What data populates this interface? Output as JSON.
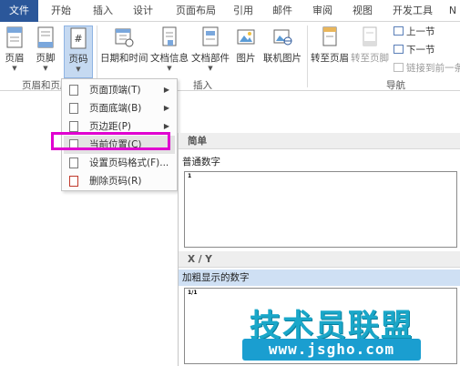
{
  "tabs": [
    {
      "label": "文件"
    },
    {
      "label": "开始"
    },
    {
      "label": "插入"
    },
    {
      "label": "设计"
    },
    {
      "label": "页面布局"
    },
    {
      "label": "引用"
    },
    {
      "label": "邮件"
    },
    {
      "label": "审阅"
    },
    {
      "label": "视图"
    },
    {
      "label": "开发工具"
    },
    {
      "label": "N"
    }
  ],
  "ribbon": {
    "header": "页眉",
    "footer": "页脚",
    "page_number": "页码",
    "datetime": "日期和时间",
    "docinfo": "文档信息",
    "quickparts": "文档部件",
    "picture": "图片",
    "onlinepic": "联机图片",
    "goto_header": "转至页眉",
    "goto_footer": "转至页脚",
    "prev_section": "上一节",
    "next_section": "下一节",
    "link_previous": "链接到前一条",
    "group_header_footer": "页眉和页脚",
    "group_insert": "插入",
    "group_nav": "导航"
  },
  "menu": {
    "items": [
      {
        "label": "页面顶端(T)"
      },
      {
        "label": "页面底端(B)"
      },
      {
        "label": "页边距(P)"
      },
      {
        "label": "当前位置(C)"
      },
      {
        "label": "设置页码格式(F)..."
      },
      {
        "label": "删除页码(R)"
      }
    ]
  },
  "gallery": {
    "section1": "简单",
    "item1": "普通数字",
    "item1_preview": "1",
    "section2": "X / Y",
    "item2": "加粗显示的数字",
    "item2_preview": "1/1"
  },
  "watermark": {
    "title": "技术员联盟",
    "url": "www.jsgho.com"
  },
  "colors": {
    "file_tab": "#2b579a",
    "highlight": "#e000d0",
    "watermark": "#1aa7c9"
  }
}
